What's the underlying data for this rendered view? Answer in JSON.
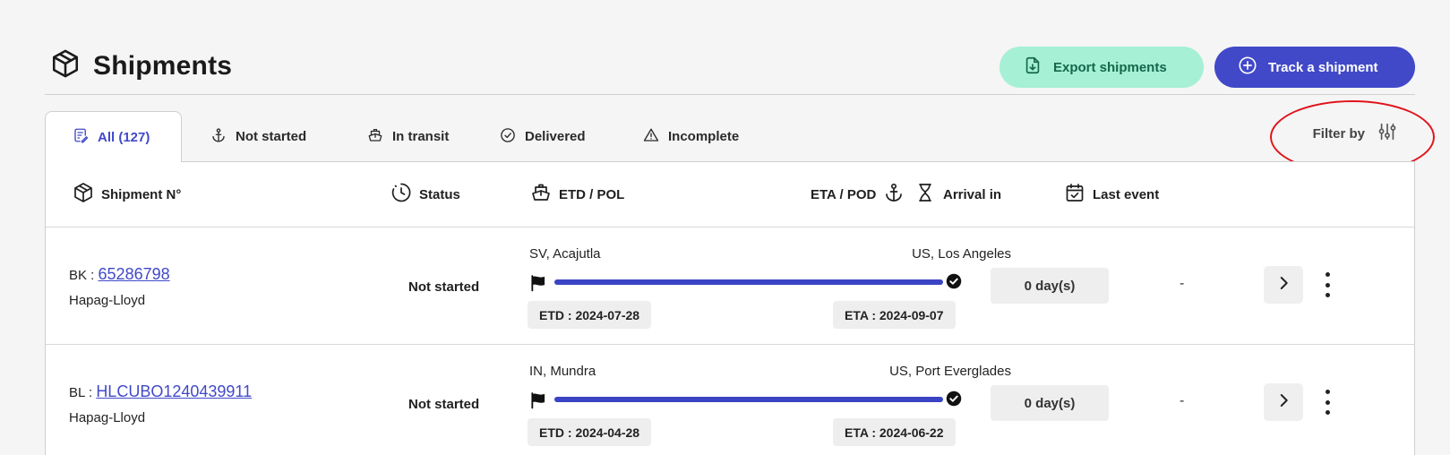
{
  "header": {
    "title": "Shipments",
    "export_label": "Export shipments",
    "track_label": "Track a shipment"
  },
  "tabs": [
    {
      "label": "All (127)",
      "icon": "list-icon"
    },
    {
      "label": "Not started",
      "icon": "anchor-icon"
    },
    {
      "label": "In transit",
      "icon": "ship-icon"
    },
    {
      "label": "Delivered",
      "icon": "check-circle-icon"
    },
    {
      "label": "Incomplete",
      "icon": "warning-icon"
    }
  ],
  "filter_label": "Filter by",
  "columns": {
    "shipment": "Shipment N°",
    "status": "Status",
    "etd_pol": "ETD / POL",
    "eta_pod": "ETA / POD",
    "arrival": "Arrival in",
    "last_event": "Last event"
  },
  "rows": [
    {
      "ref_type": "BK :",
      "ref": "65286798",
      "carrier": "Hapag-Lloyd",
      "status": "Not started",
      "pol": "SV, Acajutla",
      "pod": "US, Los Angeles",
      "etd": "ETD : 2024-07-28",
      "eta": "ETA : 2024-09-07",
      "arrival": "0 day(s)",
      "last_event": "-"
    },
    {
      "ref_type": "BL :",
      "ref": "HLCUBO1240439911",
      "carrier": "Hapag-Lloyd",
      "status": "Not started",
      "pol": "IN, Mundra",
      "pod": "US, Port Everglades",
      "etd": "ETD : 2024-04-28",
      "eta": "ETA : 2024-06-22",
      "arrival": "0 day(s)",
      "last_event": "-"
    }
  ],
  "colors": {
    "accent": "#4149c8",
    "export_bg": "#a6f0d6",
    "export_text": "#15674b",
    "annotation": "#e0141a"
  }
}
